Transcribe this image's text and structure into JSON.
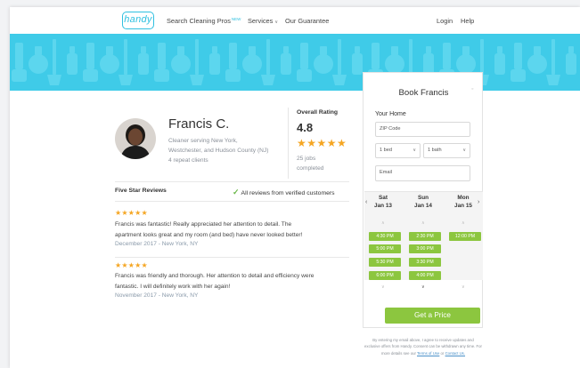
{
  "brand": {
    "logo_text": "handy",
    "accent": "#3fcbe8",
    "green": "#8cc63f",
    "star": "#f5a623"
  },
  "nav": {
    "search_label": "Search Cleaning Pros",
    "new_badge": "NEW",
    "services_label": "Services",
    "guarantee_label": "Our Guarantee",
    "login_label": "Login",
    "help_label": "Help"
  },
  "profile": {
    "name": "Francis C.",
    "serving_line1": "Cleaner serving New York,",
    "serving_line2": "Westchester, and Hudson County (NJ)",
    "repeat_clients": "4 repeat clients"
  },
  "rating": {
    "title": "Overall Rating",
    "value": "4.8",
    "stars": "★★★★★",
    "jobs_line1": "25 jobs",
    "jobs_line2": "completed"
  },
  "reviews": {
    "heading": "Five Star Reviews",
    "verified_text": "All reviews from verified customers",
    "items": [
      {
        "stars": "★★★★★",
        "line1": "Francis was fantastic! Really appreciated her attention to detail. The",
        "line2": "apartment looks great and my room (and bed) have never looked better!",
        "date": "December 2017 - New York, NY"
      },
      {
        "stars": "★★★★★",
        "line1": "Francis was friendly and thorough. Her attention to detail and efficiency were",
        "line2": "fantastic. I will definitely work with her again!",
        "date": "November 2017 - New York, NY"
      }
    ]
  },
  "booking": {
    "title": "Book Francis",
    "home_label": "Your Home",
    "zip_placeholder": "ZIP Code",
    "bed_value": "1 bed",
    "bath_value": "1 bath",
    "email_placeholder": "Email",
    "days": [
      {
        "dow": "Sat",
        "date": "Jan 13"
      },
      {
        "dow": "Sun",
        "date": "Jan 14"
      },
      {
        "dow": "Mon",
        "date": "Jan 15"
      }
    ],
    "slots": {
      "sat": [
        "4:30 PM",
        "5:00 PM",
        "5:30 PM",
        "6:00 PM"
      ],
      "sun": [
        "2:30 PM",
        "3:00 PM",
        "3:30 PM",
        "4:00 PM"
      ],
      "mon": [
        "12:00 PM"
      ]
    },
    "cta_label": "Get a Price"
  },
  "legal": {
    "text": "By entering my email above, I agree to receive updates and exclusive offers from Handy. Consent can be withdrawn any time. For more details see our",
    "terms_link": "Terms of Use",
    "or_text": "or",
    "contact_link": "Contact Us."
  }
}
